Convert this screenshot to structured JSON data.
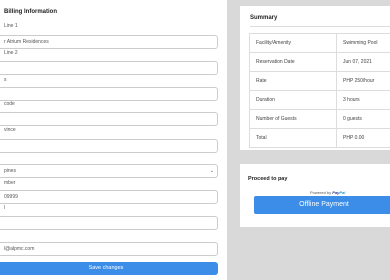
{
  "billing": {
    "title": "Billing Information",
    "address1_label": "Line 1",
    "address1_value": "r Atrium Residences",
    "address2_label": "Line 2",
    "address2_value": "",
    "field_a_label": "s",
    "field_a_value": "",
    "zip_label": "code",
    "zip_value": "",
    "province_label": "vince",
    "province_value": "",
    "country_value": "pines",
    "phone_label": "mber",
    "phone_value": "09999",
    "field_b_label": "l",
    "field_b_value": "",
    "field_c_value": "",
    "email_value": "l@alpmc.com",
    "save_label": "Save changes"
  },
  "summary": {
    "title": "Summary",
    "rows": [
      {
        "label": "Facility/Amenity",
        "value": "Swimming Pool"
      },
      {
        "label": "Reservation Date",
        "value": "Jun 07, 2021"
      },
      {
        "label": "Rate",
        "value": "PHP 250/hour"
      },
      {
        "label": "Duration",
        "value": "3 hours"
      },
      {
        "label": "Number of Guests",
        "value": "0 guests"
      },
      {
        "label": "Total",
        "value": "PHP 0.00"
      }
    ]
  },
  "payment": {
    "title": "Proceed to pay",
    "powered_by": "Powered by",
    "paypal_a": "Pay",
    "paypal_b": "Pal",
    "offline_label": "Offline Payment"
  },
  "icons": {
    "select_chevron": "chevron-down-icon"
  }
}
